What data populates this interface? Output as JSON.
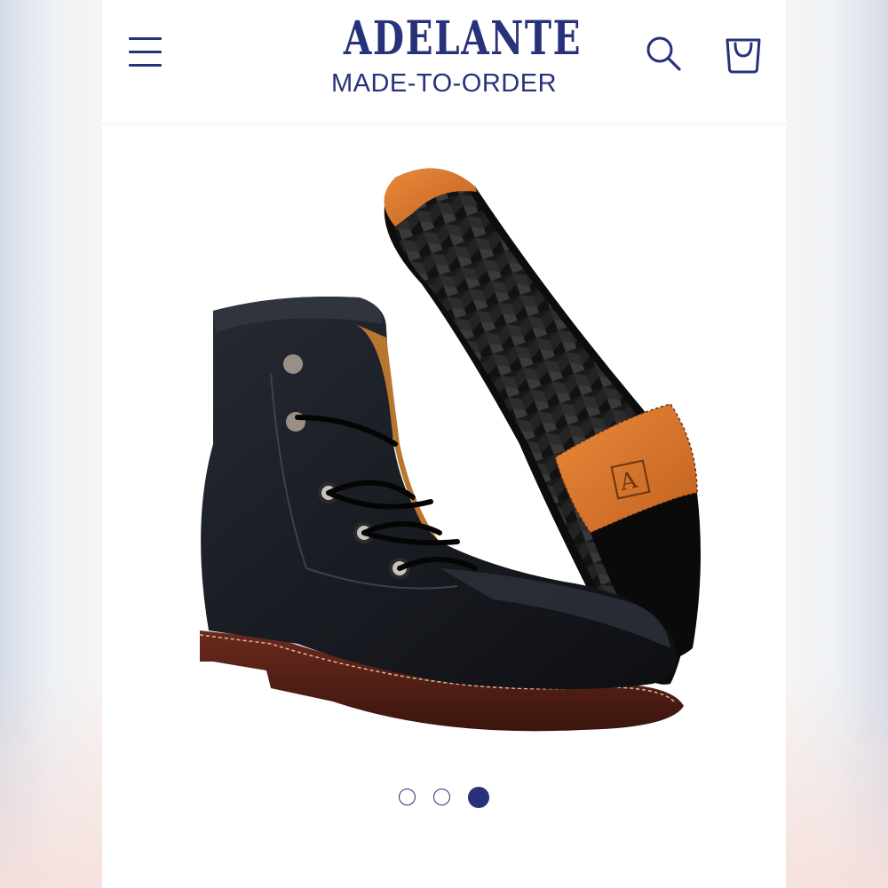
{
  "header": {
    "brand_name": "ADELANTE",
    "brand_tagline": "MADE-TO-ORDER",
    "menu_icon": "hamburger-menu-icon",
    "search_icon": "search-icon",
    "cart_icon": "shopping-bag-icon"
  },
  "product_gallery": {
    "image": "black leather lace-up boot with cognac leather sole",
    "sole_logo_letter": "A",
    "slide_count": 3,
    "active_slide": 3
  },
  "colors": {
    "brand_navy": "#27327a",
    "background": "#ffffff",
    "sole_leather": "#d97a2e"
  }
}
